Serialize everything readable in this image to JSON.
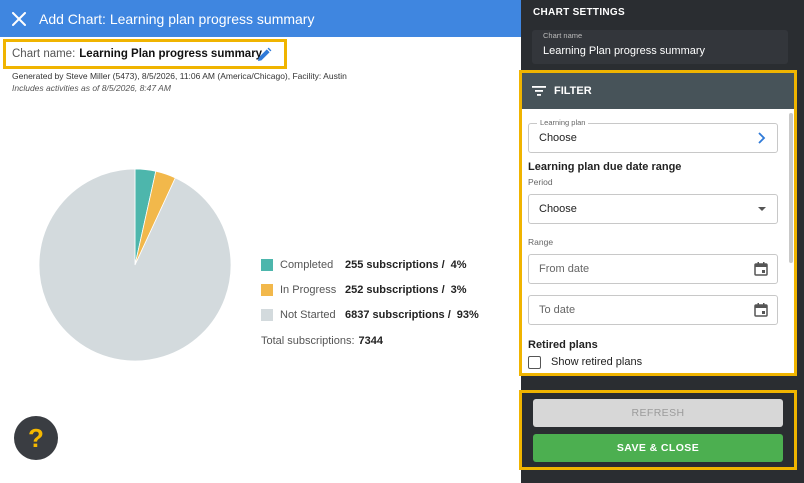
{
  "header": {
    "title": "Add Chart: Learning plan progress summary"
  },
  "chart_name": {
    "label": "Chart name:",
    "value": "Learning Plan progress summary"
  },
  "meta": {
    "generated": "Generated by Steve Miller (5473), 8/5/2026, 11:06 AM (America/Chicago), Facility: Austin",
    "includes": "Includes activities as of 8/5/2026, 8:47 AM"
  },
  "chart_data": {
    "type": "pie",
    "categories": [
      "Completed",
      "In Progress",
      "Not Started"
    ],
    "values": [
      255,
      252,
      6837
    ],
    "percent_labels": [
      "4%",
      "3%",
      "93%"
    ],
    "subscription_labels": [
      "255 subscriptions /",
      "252 subscriptions /",
      "6837 subscriptions /"
    ],
    "colors": [
      "#4db6ac",
      "#f2b84b",
      "#d3dadd"
    ],
    "total_label": "Total subscriptions:",
    "total_value": "7344"
  },
  "panel": {
    "title": "CHART SETTINGS",
    "chart_name_label": "Chart name",
    "chart_name_value": "Learning Plan progress summary"
  },
  "filter": {
    "title": "FILTER",
    "learning_plan_label": "Learning plan",
    "learning_plan_value": "Choose",
    "due_range_title": "Learning plan due date range",
    "period_label": "Period",
    "period_value": "Choose",
    "range_label": "Range",
    "from_placeholder": "From date",
    "to_placeholder": "To date",
    "retired_title": "Retired plans",
    "show_retired_label": "Show retired plans"
  },
  "buttons": {
    "refresh": "REFRESH",
    "save_close": "SAVE & CLOSE"
  },
  "help": {
    "glyph": "?"
  }
}
